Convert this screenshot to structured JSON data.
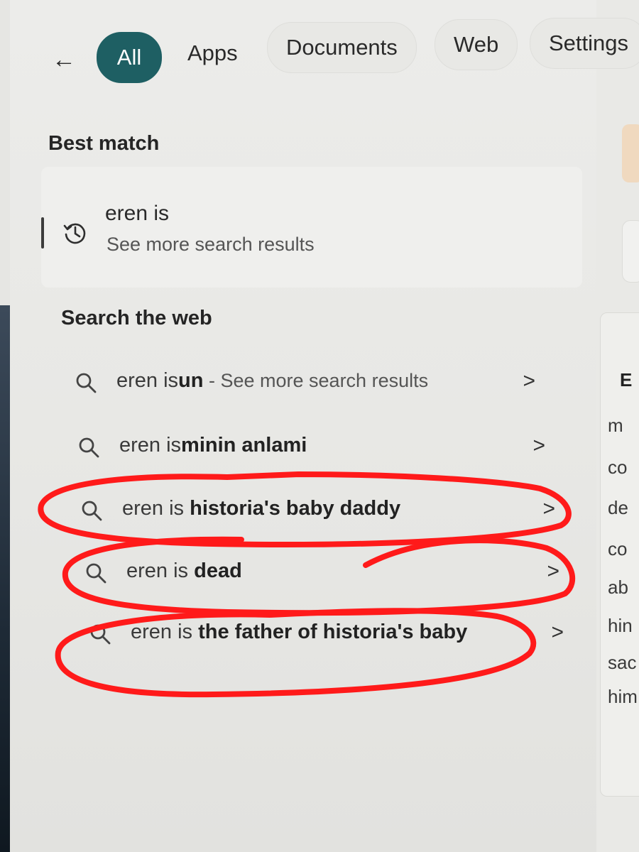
{
  "tabs": {
    "back": "←",
    "all": "All",
    "apps": "Apps",
    "documents": "Documents",
    "web": "Web",
    "settings": "Settings"
  },
  "best_match": {
    "title": "Best match",
    "item_title": "eren is",
    "item_subtitle": "See more search results",
    "icon": "history-icon"
  },
  "search_web": {
    "title": "Search the web",
    "suggestions": [
      {
        "prefix": "eren is",
        "bold": "un",
        "suffix": " - See more search results"
      },
      {
        "prefix": "eren is",
        "bold": "minin anlami",
        "suffix": ""
      },
      {
        "prefix": "eren is ",
        "bold": "historia's baby daddy",
        "suffix": ""
      },
      {
        "prefix": "eren is ",
        "bold": "dead",
        "suffix": ""
      },
      {
        "prefix": "eren is ",
        "bold": "the father of historia's baby",
        "suffix": ""
      }
    ],
    "chevron": ">"
  },
  "side_preview": {
    "heading": "E",
    "words": [
      "m",
      "co",
      "de",
      "co",
      "ab",
      "hin",
      "sac",
      "him"
    ]
  },
  "colors": {
    "accent": "#1e5f63",
    "annotation": "#ff1a1a"
  }
}
